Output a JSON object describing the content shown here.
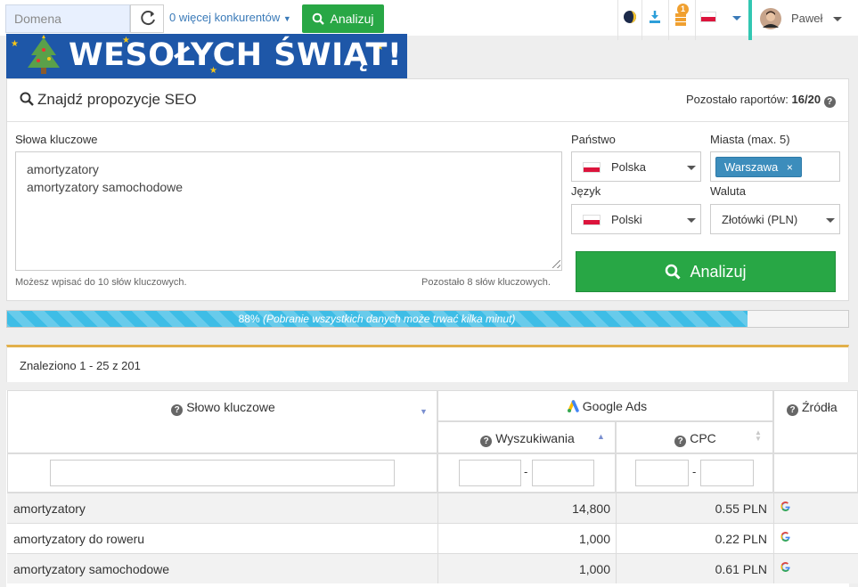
{
  "header": {
    "domain_placeholder": "Domena",
    "competitors_label": "0 więcej konkurentów",
    "analyze_label": "Analizuj",
    "notification_count": "1",
    "user_name": "Paweł"
  },
  "banner": {
    "text": "WESOŁYCH ŚWIĄT!"
  },
  "panel": {
    "title": "Znajdź propozycje SEO",
    "remaining_prefix": "Pozostało raportów:",
    "remaining_value": "16/20",
    "keywords_label": "Słowa kluczowe",
    "keywords_text": "amortyzatory\namortyzatory samochodowe",
    "hint_left": "Możesz wpisać do 10 słów kluczowych.",
    "hint_right": "Pozostało 8 słów kluczowych.",
    "country_label": "Państwo",
    "country_value": "Polska",
    "cities_label": "Miasta (max. 5)",
    "city_tag": "Warszawa",
    "language_label": "Język",
    "language_value": "Polski",
    "currency_label": "Waluta",
    "currency_value": "Złotówki (PLN)",
    "analyze_label": "Analizuj"
  },
  "progress": {
    "percent": 88,
    "text": "88% (Pobranie wszystkich danych może trwać kilka minut)"
  },
  "results": {
    "found_text": "Znaleziono 1 - 25 z 201",
    "headers": {
      "keyword": "Słowo kluczowe",
      "google_ads": "Google Ads",
      "sources": "Źródła",
      "searches": "Wyszukiwania",
      "cpc": "CPC"
    },
    "range_sep": "-",
    "rows": [
      {
        "keyword": "amortyzatory",
        "searches": "14,800",
        "cpc": "0.55 PLN",
        "source": "G"
      },
      {
        "keyword": "amortyzatory do roweru",
        "searches": "1,000",
        "cpc": "0.22 PLN",
        "source": "G"
      },
      {
        "keyword": "amortyzatory samochodowe",
        "searches": "1,000",
        "cpc": "0.61 PLN",
        "source": "G"
      }
    ]
  },
  "colors": {
    "green": "#28a745",
    "progress": "#3ebde6",
    "tag": "#3c8dbc",
    "banner": "#1e57a8",
    "accent_orange": "#e2b04a"
  }
}
